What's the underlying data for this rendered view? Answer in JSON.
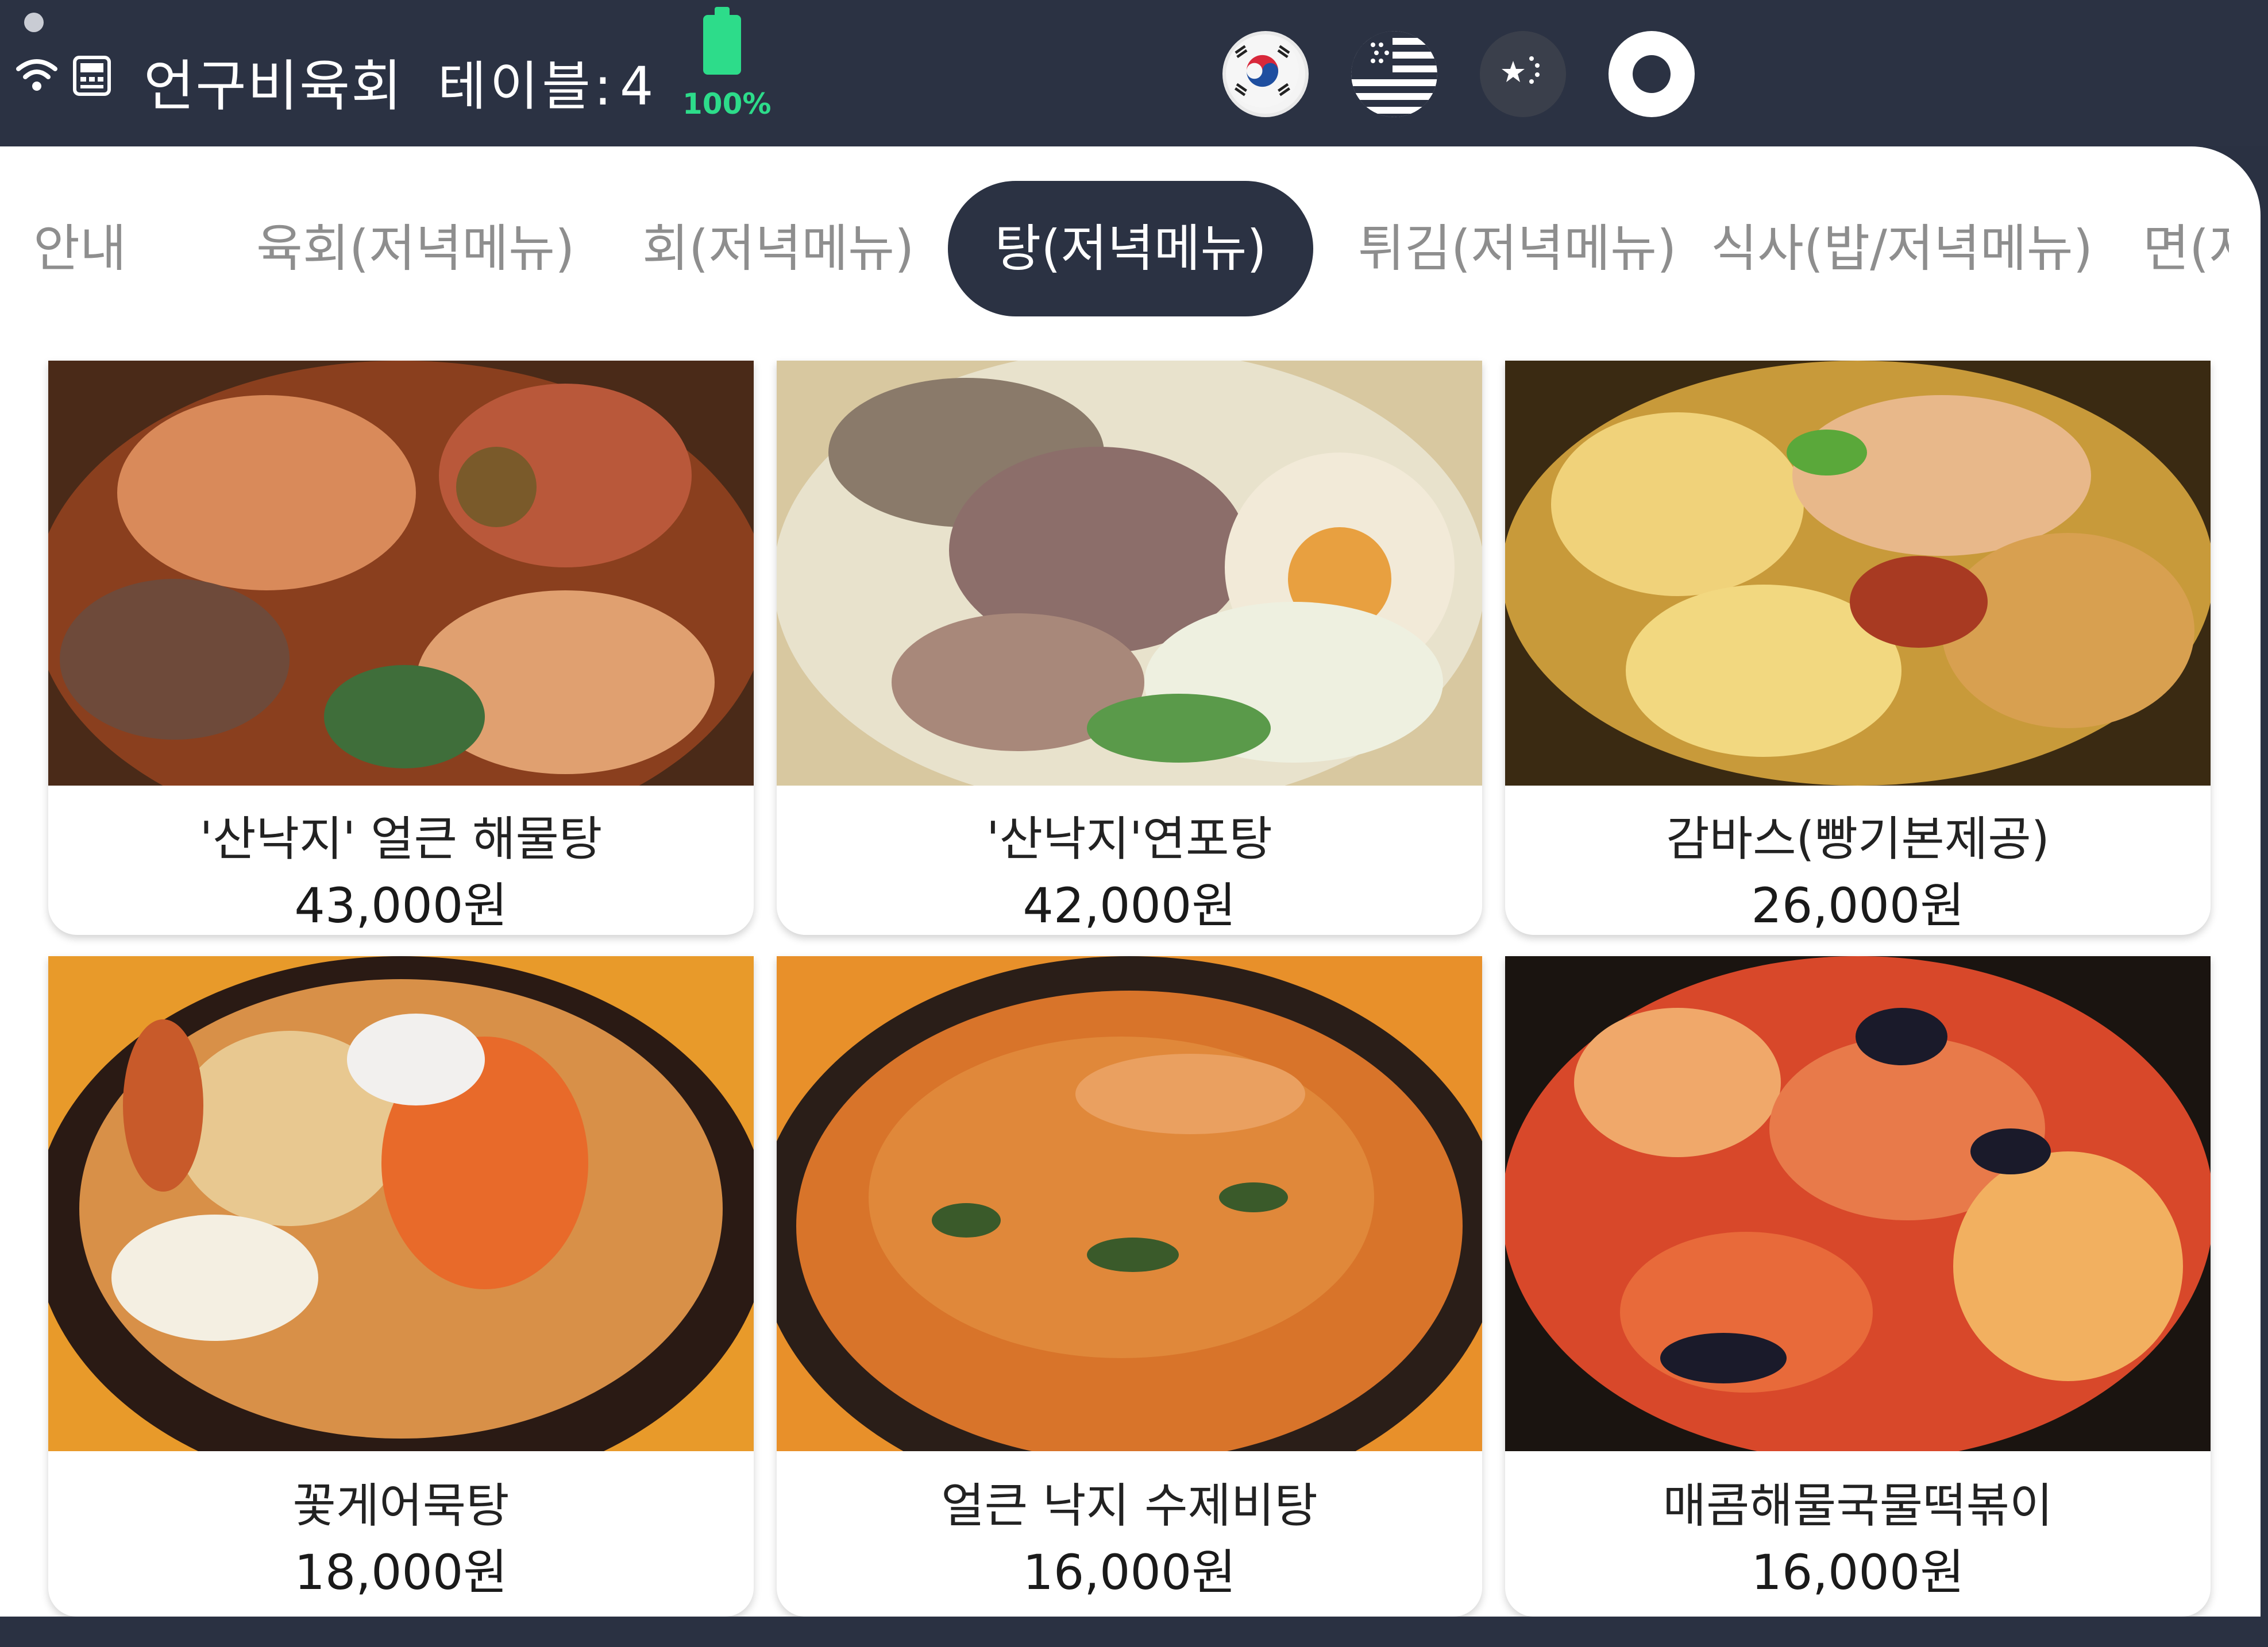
{
  "header": {
    "store_name": "언구비육회",
    "table_label": "테이블:",
    "table_number": "4",
    "battery_text": "100%",
    "battery_level": 1.0,
    "icons": [
      "wifi-icon",
      "pos-terminal-icon",
      "battery-icon"
    ],
    "languages": [
      {
        "name": "korean-flag-icon"
      },
      {
        "name": "us-flag-icon"
      },
      {
        "name": "china-flag-icon"
      }
    ],
    "record_icon": "record-button-icon"
  },
  "tabs": [
    {
      "label": "안내"
    },
    {
      "label": "육회(저녁메뉴)"
    },
    {
      "label": "회(저녁메뉴)"
    },
    {
      "label": "탕(저녁메뉴)",
      "active": true
    },
    {
      "label": "튀김(저녁메뉴)"
    },
    {
      "label": "식사(밥/저녁메뉴)"
    },
    {
      "label": "면(저"
    }
  ],
  "menu_items": [
    {
      "name": "'산낙지' 얼큰 해물탕",
      "price": "43,000원"
    },
    {
      "name": "'산낙지'연포탕",
      "price": "42,000원"
    },
    {
      "name": "감바스(빵기본제공)",
      "price": "26,000원"
    },
    {
      "name": "꽃게어묵탕",
      "price": "18,000원"
    },
    {
      "name": "얼큰 낙지 수제비탕",
      "price": "16,000원"
    },
    {
      "name": "매콤해물국물떡볶이",
      "price": "16,000원"
    }
  ],
  "colors": {
    "header_bg": "#2b3243",
    "battery": "#2ddc8a",
    "tab_inactive": "#8e8e8e",
    "tab_active_bg": "#2b3243"
  }
}
